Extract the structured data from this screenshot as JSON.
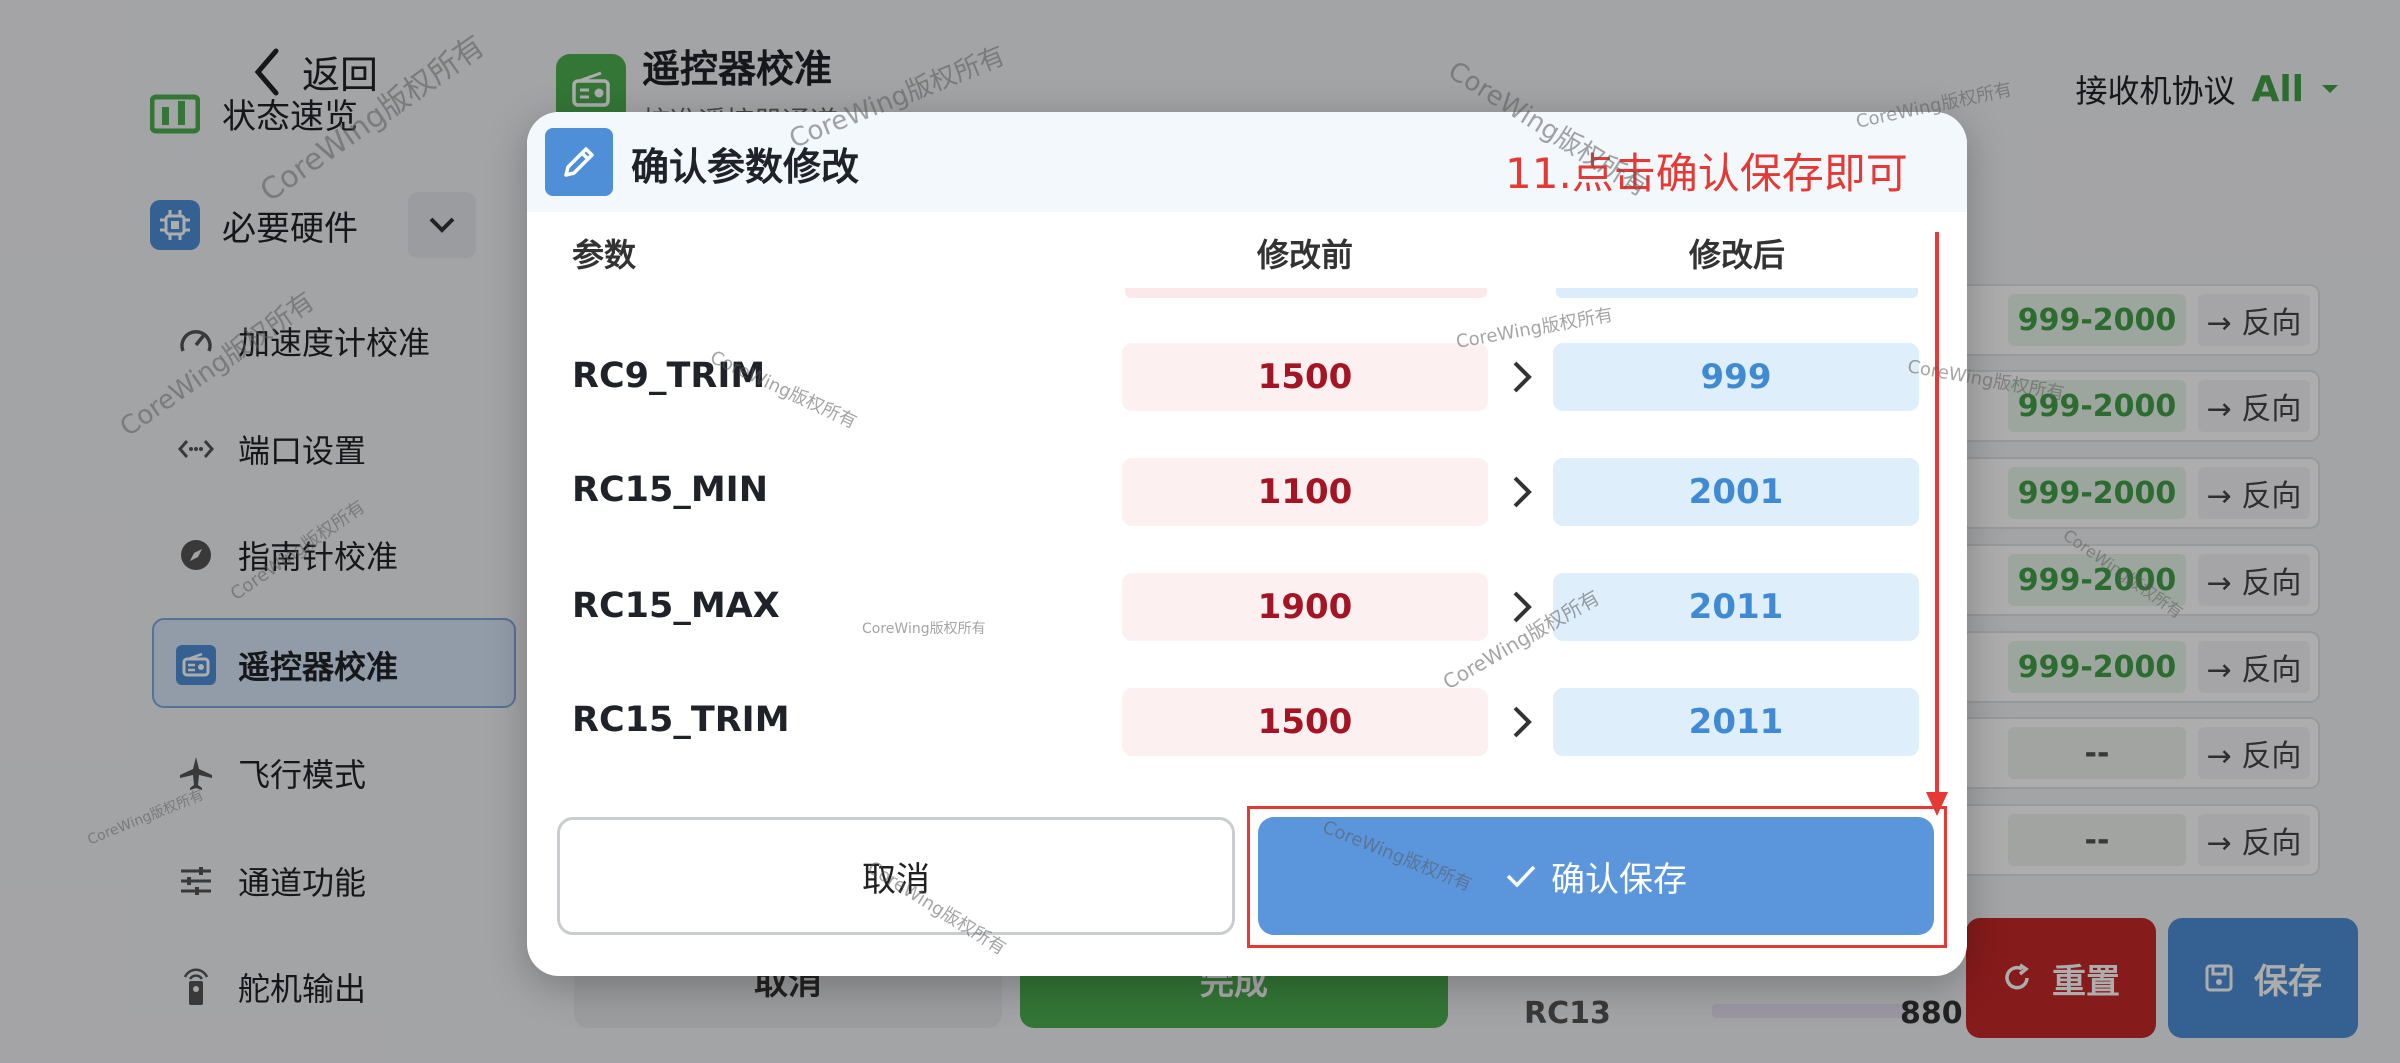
{
  "sidebar": {
    "back_label": "返回",
    "items": [
      {
        "label": "状态速览"
      },
      {
        "label": "必要硬件"
      },
      {
        "label": "加速度计校准"
      },
      {
        "label": "端口设置"
      },
      {
        "label": "指南针校准"
      },
      {
        "label": "遥控器校准"
      },
      {
        "label": "飞行模式"
      },
      {
        "label": "通道功能"
      },
      {
        "label": "舵机输出"
      }
    ]
  },
  "header": {
    "title": "遥控器校准",
    "subtitle": "校准遥控器通道",
    "protocol_label": "接收机协议",
    "protocol_value": "All"
  },
  "channels": {
    "rows": [
      {
        "range": "999-2000",
        "reverse": "→ 反向"
      },
      {
        "range": "999-2000",
        "reverse": "→ 反向"
      },
      {
        "range": "999-2000",
        "reverse": "→ 反向"
      },
      {
        "range": "999-2000",
        "reverse": "→ 反向"
      },
      {
        "range": "999-2000",
        "reverse": "→ 反向"
      },
      {
        "range": "--",
        "reverse": "→ 反向"
      },
      {
        "range": "--",
        "reverse": "→ 反向"
      }
    ],
    "partial_label": "RC13",
    "partial_value": "880"
  },
  "bottom": {
    "cancel": "取消",
    "done": "完成",
    "reset": "重置",
    "save": "保存"
  },
  "dialog": {
    "title": "确认参数修改",
    "annotation": "11.点击确认保存即可",
    "col_param": "参数",
    "col_before": "修改前",
    "col_after": "修改后",
    "rows": [
      {
        "name": "RC9_TRIM",
        "before": "1500",
        "after": "999"
      },
      {
        "name": "RC15_MIN",
        "before": "1100",
        "after": "2001"
      },
      {
        "name": "RC15_MAX",
        "before": "1900",
        "after": "2011"
      },
      {
        "name": "RC15_TRIM",
        "before": "1500",
        "after": "2011"
      }
    ],
    "cancel_label": "取消",
    "confirm_label": "确认保存"
  },
  "watermark": "CoreWing版权所有",
  "colors": {
    "accent_blue": "#5b96dd",
    "annotation_red": "#e53935",
    "before_text": "#a31525",
    "after_text": "#3f8ad2",
    "green": "#43a047"
  }
}
